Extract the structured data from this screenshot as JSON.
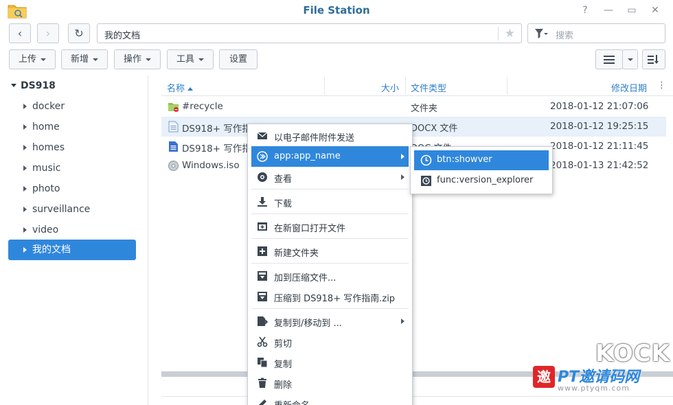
{
  "window": {
    "title": "File Station",
    "help": "?",
    "minimize": "—",
    "maximize": "▭",
    "close": "✕"
  },
  "nav": {
    "back": "‹",
    "forward": "›",
    "refresh": "↻",
    "path": "我的文档",
    "favorite_icon": "★",
    "search_placeholder": "搜索"
  },
  "toolbar": {
    "upload": "上传",
    "create": "新增",
    "action": "操作",
    "tools": "工具",
    "settings": "设置"
  },
  "sidebar": {
    "root": "DS918",
    "items": [
      {
        "label": "docker"
      },
      {
        "label": "home"
      },
      {
        "label": "homes"
      },
      {
        "label": "music"
      },
      {
        "label": "photo"
      },
      {
        "label": "surveillance"
      },
      {
        "label": "video"
      },
      {
        "label": "我的文档",
        "selected": true
      }
    ]
  },
  "list": {
    "columns": {
      "name": "名称",
      "size": "大小",
      "type": "文件类型",
      "modified": "修改日期"
    },
    "rows": [
      {
        "name": "#recycle",
        "type": "文件夹",
        "date": "2018-01-12 21:07:06",
        "icon": "recycle-folder-icon"
      },
      {
        "name": "DS918+ 写作指",
        "type": "DOCX 文件",
        "date": "2018-01-12 19:25:15",
        "icon": "document-icon"
      },
      {
        "name": "DS918+ 写作指",
        "type": "DOC 文件",
        "date": "2018-01-12 21:11:45",
        "icon": "word-document-icon"
      },
      {
        "name": "Windows.iso",
        "type": "",
        "date": "2018-01-13 21:42:52",
        "icon": "disc-image-icon"
      }
    ]
  },
  "context_menu": {
    "items": [
      {
        "label": "以电子邮件附件发送",
        "icon": "envelope-icon"
      },
      {
        "label": "app:app_name",
        "icon": "app-icon",
        "active": true,
        "submenu": true
      },
      {
        "label": "查看",
        "icon": "eye-icon",
        "submenu": true
      },
      {
        "label": "下载",
        "icon": "download-icon"
      },
      {
        "label": "在新窗口打开文件",
        "icon": "new-window-icon"
      },
      {
        "label": "新建文件夹",
        "icon": "new-folder-icon"
      },
      {
        "label": "加到压缩文件...",
        "icon": "archive-icon"
      },
      {
        "label": "压缩到 DS918+ 写作指南.zip",
        "icon": "compress-icon"
      },
      {
        "label": "复制到/移动到 ...",
        "icon": "copy-move-icon",
        "submenu": true
      },
      {
        "label": "剪切",
        "icon": "scissors-icon"
      },
      {
        "label": "复制",
        "icon": "copy-icon"
      },
      {
        "label": "删除",
        "icon": "trash-icon"
      },
      {
        "label": "重新命名",
        "icon": "pencil-icon"
      }
    ]
  },
  "submenu": {
    "items": [
      {
        "label": "btn:showver",
        "icon": "clock-icon",
        "active": true
      },
      {
        "label": "func:version_explorer",
        "icon": "version-icon"
      }
    ]
  },
  "watermark": {
    "brand": "KOCK",
    "site": "PT邀请码网",
    "seal": "邀",
    "url": "www.ptyqm.com"
  },
  "colors": {
    "accent": "#2f87dc",
    "title": "#2f6d9c",
    "header_text": "#2f7fc9"
  }
}
